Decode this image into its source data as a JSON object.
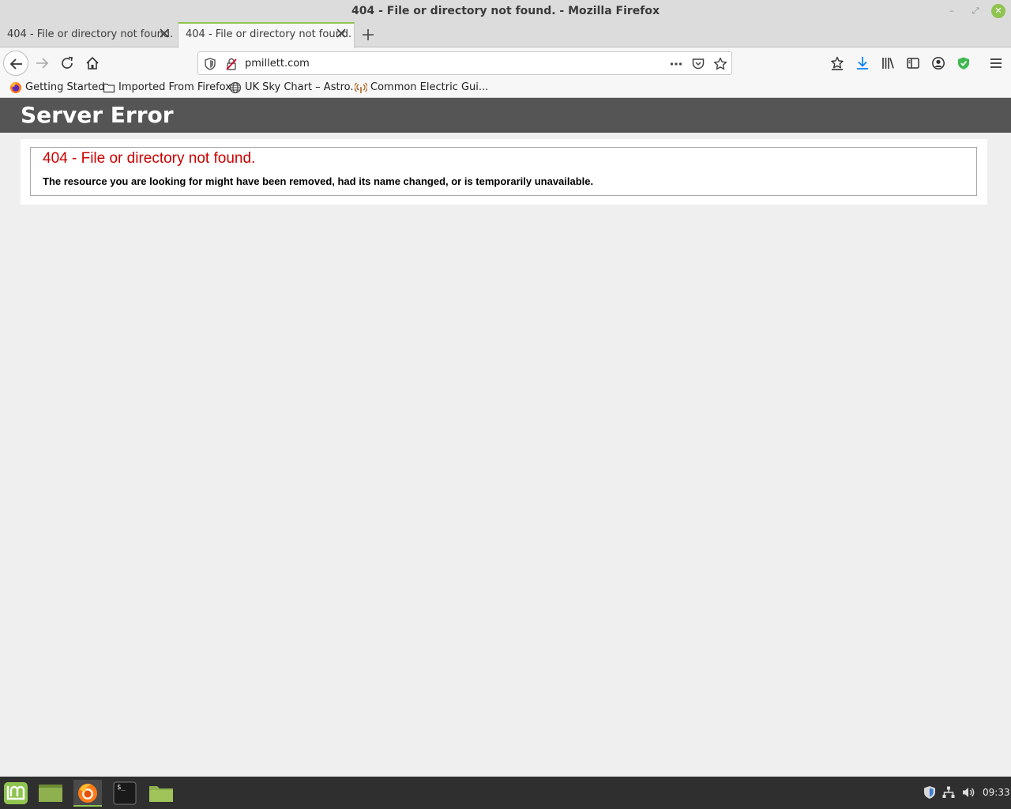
{
  "window": {
    "title": "404 - File or directory not found. - Mozilla Firefox",
    "minimize_glyph": "–",
    "maximize_glyph": "⤢",
    "close_glyph": "✕"
  },
  "tabs": [
    {
      "label": "404 - File or directory not found.",
      "active": false
    },
    {
      "label": "404 - File or directory not found.",
      "active": true
    }
  ],
  "navbar": {
    "url": "pmillett.com",
    "icons": [
      "back-arrow-icon",
      "forward-arrow-icon",
      "reload-icon",
      "home-icon",
      "tracking-shield-icon",
      "insecure-lock-icon",
      "more-actions-icon",
      "pocket-icon",
      "bookmark-star-icon",
      "reading-list-icon",
      "download-icon",
      "library-icon",
      "sidebar-icon",
      "account-icon",
      "adblock-shield-icon",
      "menu-icon"
    ]
  },
  "bookmarks": [
    {
      "label": "Getting Started",
      "icon": "firefox-icon"
    },
    {
      "label": "Imported From Firefox",
      "icon": "folder-icon"
    },
    {
      "label": "UK Sky Chart – Astro...",
      "icon": "globe-icon"
    },
    {
      "label": "Common Electric Gui...",
      "icon": "signal-icon"
    }
  ],
  "page": {
    "header": "Server Error",
    "error_title": "404 - File or directory not found.",
    "error_message": "The resource you are looking for might have been removed, had its name changed, or is temporarily unavailable."
  },
  "colors": {
    "accent_green": "#8fc44f",
    "error_red": "#cc0000",
    "header_gray": "#555555"
  },
  "taskbar": {
    "items": [
      "mint-menu-icon",
      "show-desktop-icon",
      "firefox-icon",
      "terminal-icon",
      "files-icon"
    ],
    "terminal_glyph": "$_",
    "clock": "09:33"
  }
}
